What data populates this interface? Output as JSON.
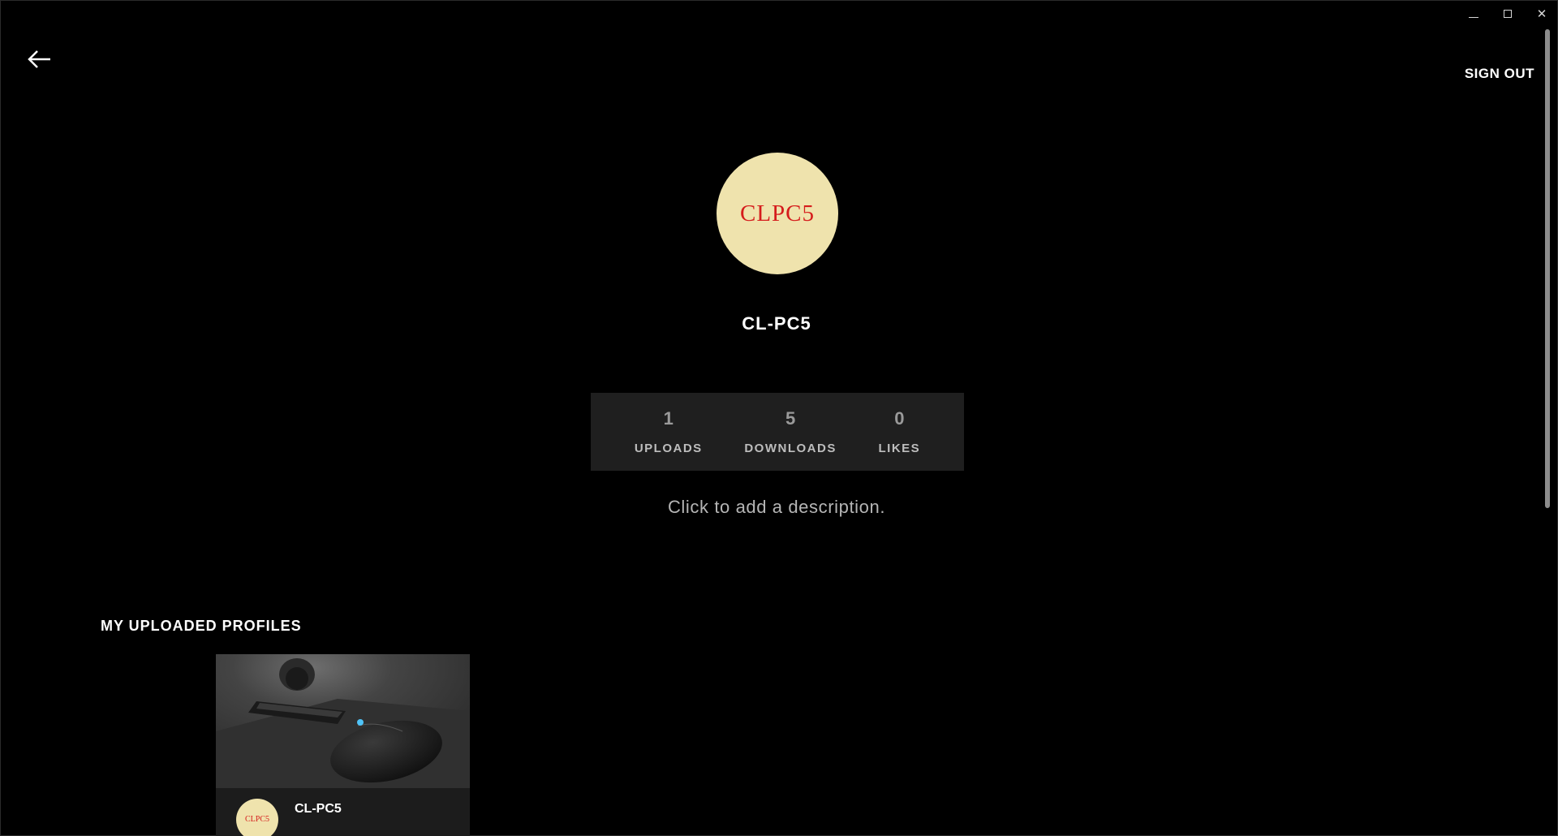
{
  "window": {
    "controls": {
      "minimize_icon": "minimize-icon",
      "maximize_icon": "maximize-icon",
      "close_symbol": "✕"
    }
  },
  "header": {
    "back_icon": "back-arrow-icon",
    "sign_out_label": "SIGN OUT"
  },
  "profile": {
    "avatar_text": "CLPC5",
    "username": "CL-PC5",
    "description_placeholder": "Click to add a description.",
    "avatar_bg": "#efe3ad",
    "avatar_fg": "#d51c1c"
  },
  "stats": [
    {
      "value": "1",
      "label": "UPLOADS"
    },
    {
      "value": "5",
      "label": "DOWNLOADS"
    },
    {
      "value": "0",
      "label": "LIKES"
    }
  ],
  "uploaded_profiles": {
    "title": "MY UPLOADED PROFILES",
    "cards": [
      {
        "avatar_text": "CLPC5",
        "name": "CL-PC5",
        "image": "gaming-mouse-keyboard-photo"
      }
    ]
  }
}
